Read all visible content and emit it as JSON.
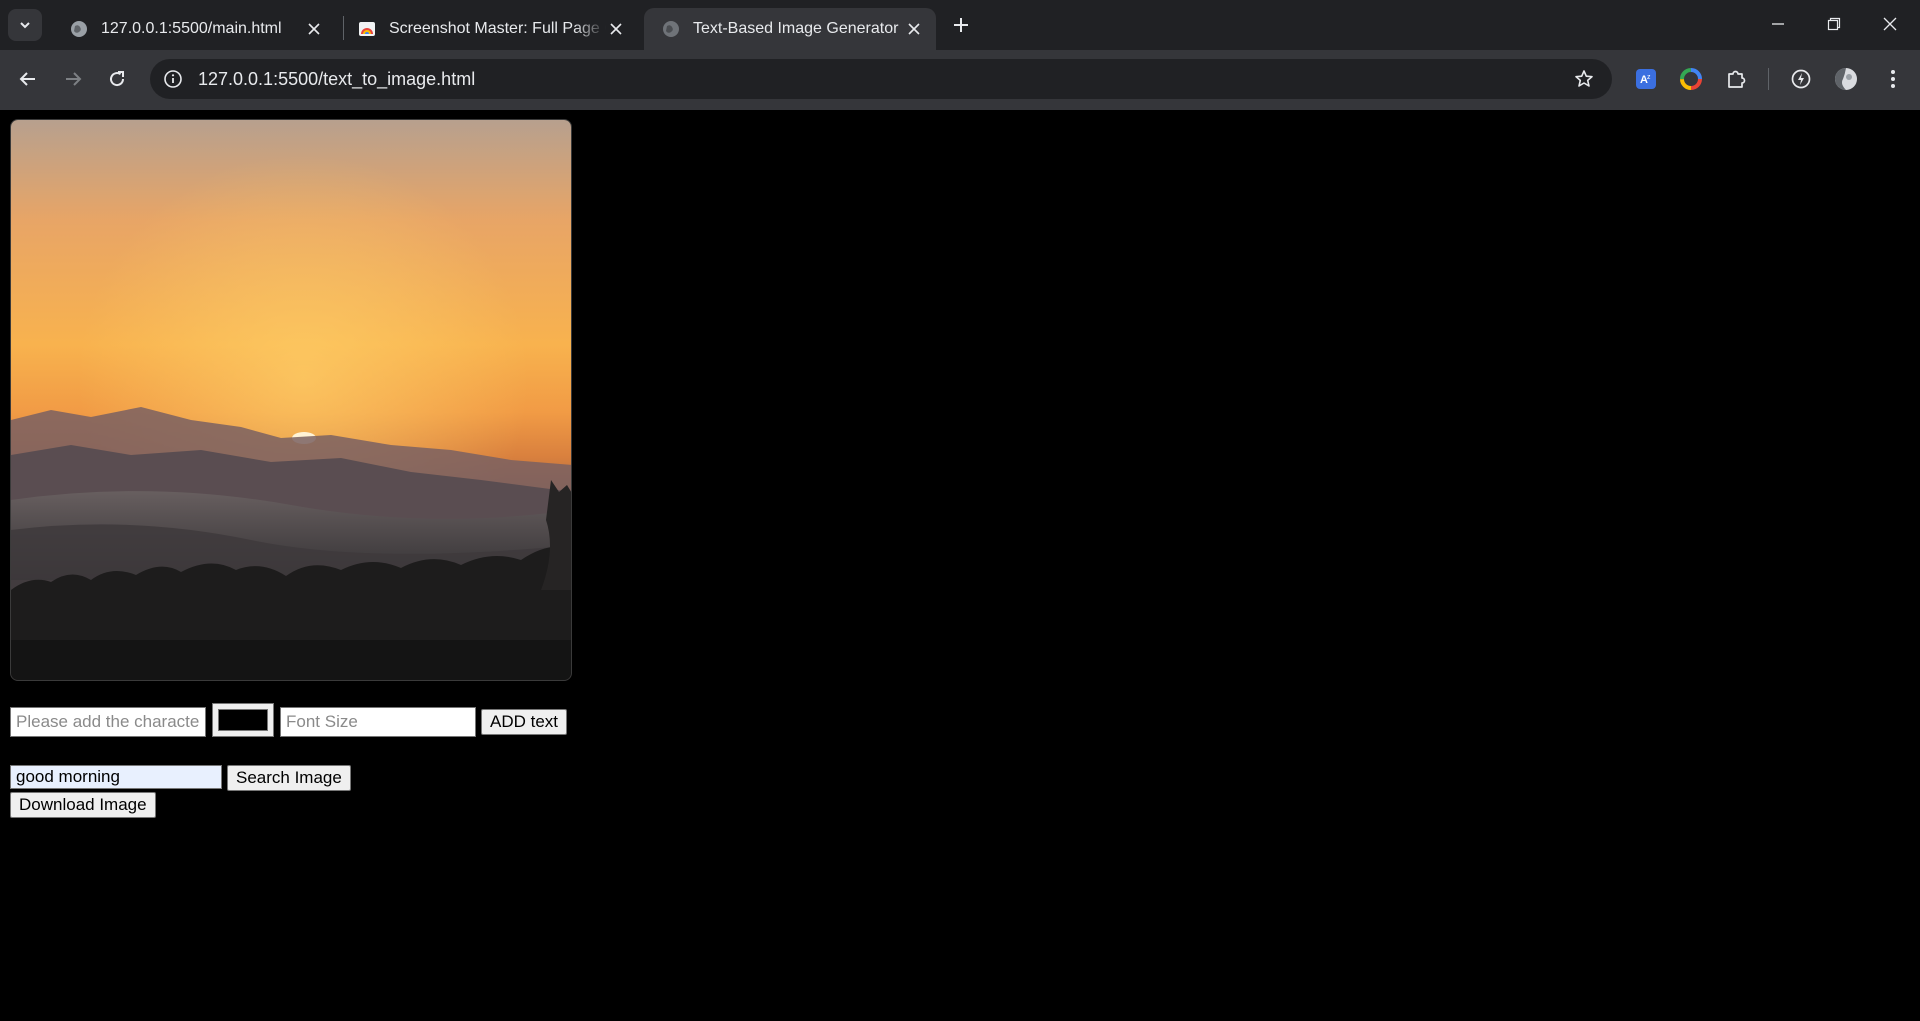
{
  "browser": {
    "tabs": [
      {
        "title": "127.0.0.1:5500/main.html",
        "favicon": "globe-icon",
        "active": false
      },
      {
        "title": "Screenshot Master: Full Page Ca",
        "favicon": "screenshot-master-icon",
        "active": false
      },
      {
        "title": "Text-Based Image Generator",
        "favicon": "globe-icon",
        "active": true
      }
    ],
    "url": "127.0.0.1:5500/text_to_image.html",
    "extensions": [
      "translate-icon",
      "color-wheel-icon",
      "puzzle-icon",
      "performance-icon",
      "profile-icon",
      "menu-icon"
    ]
  },
  "page": {
    "image": {
      "description_icon": "sunrise-landscape-image"
    },
    "text_input": {
      "placeholder": "Please add the character",
      "value": ""
    },
    "color_picker": {
      "value": "#000000"
    },
    "font_size_input": {
      "placeholder": "Font Size",
      "value": ""
    },
    "add_text_button": "ADD text",
    "search_input": {
      "value": "good morning",
      "placeholder": ""
    },
    "search_button": "Search Image",
    "download_button": "Download Image"
  },
  "colors": {
    "tabstrip": "#202124",
    "toolbar": "#35363a",
    "page_background": "#000000"
  }
}
